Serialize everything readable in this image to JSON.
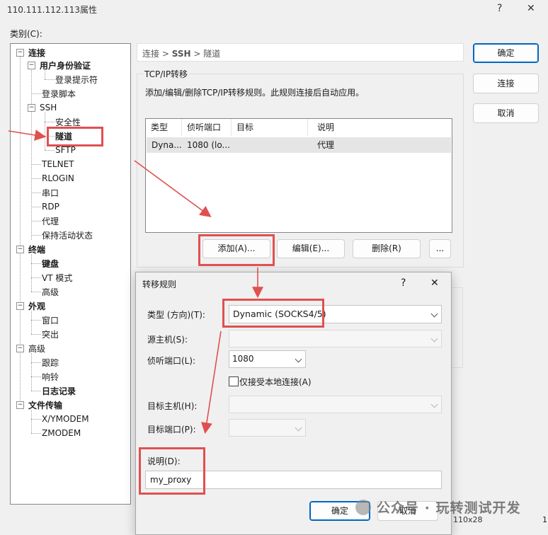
{
  "window": {
    "title": "110.111.112.113属性",
    "help_glyph": "?",
    "close_glyph": "✕"
  },
  "category_label": "类别(C):",
  "tree": {
    "connection": "连接",
    "auth": "用户身份验证",
    "login_prompt": "登录提示符",
    "login_script": "登录脚本",
    "ssh": "SSH",
    "security": "安全性",
    "tunnel": "隧道",
    "sftp": "SFTP",
    "telnet": "TELNET",
    "rlogin": "RLOGIN",
    "serial": "串口",
    "rdp": "RDP",
    "proxy": "代理",
    "keepalive": "保持活动状态",
    "terminal": "终端",
    "keyboard": "键盘",
    "vt_mode": "VT 模式",
    "advanced": "高级",
    "appearance": "外观",
    "window": "窗口",
    "highlight": "突出",
    "advanced2": "高级",
    "trace": "跟踪",
    "bell": "响铃",
    "logging": "日志记录",
    "file_transfer": "文件传输",
    "xymodem": "X/YMODEM",
    "zmodem": "ZMODEM",
    "expander_minus": "−"
  },
  "breadcrumb": {
    "part1": "连接",
    "sep": ">",
    "part2": "SSH",
    "part3": "隧道"
  },
  "tcpip": {
    "group_label": "TCP/IP转移",
    "description": "添加/编辑/删除TCP/IP转移规则。此规则连接后自动应用。",
    "columns": [
      "类型",
      "侦听端口",
      "目标",
      "说明"
    ],
    "row": {
      "type": "Dyna...",
      "listen": "1080 (lo...",
      "target": "",
      "desc": "代理"
    },
    "add_button": "添加(A)...",
    "edit_button": "编辑(E)...",
    "delete_button": "删除(R)",
    "more_button": "..."
  },
  "side_buttons": {
    "ok": "确定",
    "connect": "连接",
    "cancel": "取消"
  },
  "dialog": {
    "title": "转移规则",
    "help_glyph": "?",
    "close_glyph": "✕",
    "type_label": "类型 (方向)(T):",
    "type_value": "Dynamic (SOCKS4/5)",
    "source_host_label": "源主机(S):",
    "listen_port_label": "侦听端口(L):",
    "listen_port_value": "1080",
    "local_only_label": "仅接受本地连接(A)",
    "local_only_checked": false,
    "target_host_label": "目标主机(H):",
    "target_port_label": "目标端口(P):",
    "desc_label": "说明(D):",
    "desc_value": "my_proxy",
    "ok_button": "确定",
    "cancel_button": "取消"
  },
  "status": {
    "size": "110x28",
    "extra": "1"
  },
  "watermark": "公众号 · 玩转测试开发",
  "colors": {
    "annotation_red": "#e05050",
    "accent": "#0067c0"
  }
}
